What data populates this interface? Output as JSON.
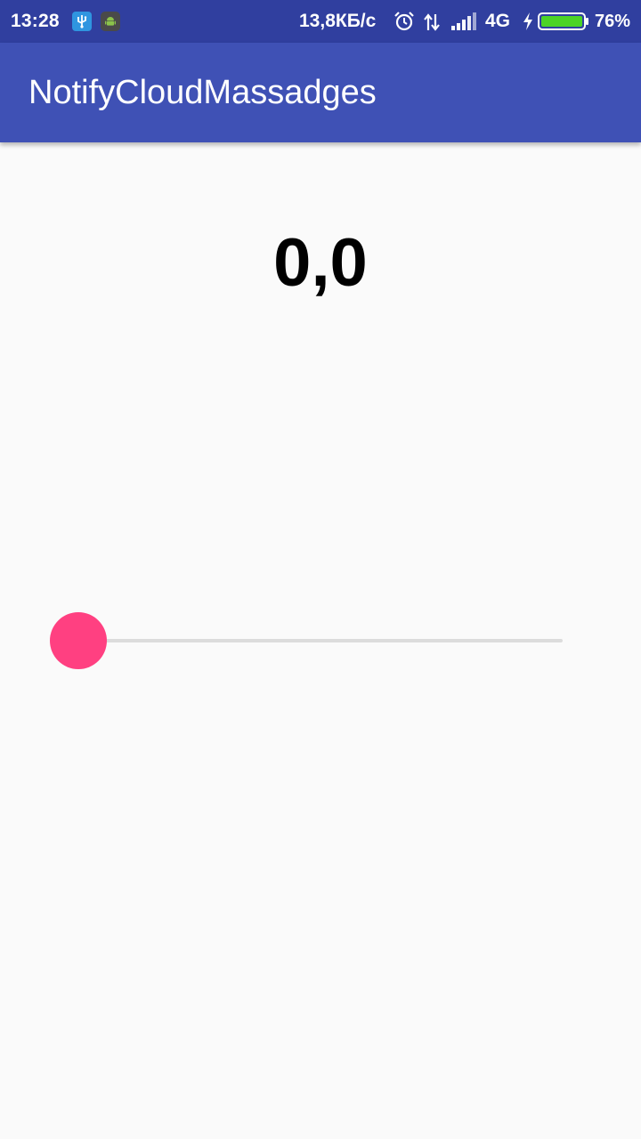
{
  "status_bar": {
    "time": "13:28",
    "usb_icon": "usb-icon",
    "android_icon": "android-debug-icon",
    "net_speed": "13,8КБ/с",
    "alarm_icon": "alarm-clock-icon",
    "data_icon": "data-transfer-icon",
    "signal_icon": "cell-signal-icon",
    "network_type": "4G",
    "charging_icon": "charging-bolt-icon",
    "battery_icon": "battery-icon",
    "battery_level": 76,
    "battery_percent": "76%",
    "background_color": "#303f9f",
    "usb_icon_color": "#2f95e0",
    "battery_fill_color": "#4cd327"
  },
  "toolbar": {
    "title": "NotifyCloudMassadges",
    "background_color": "#3f51b5"
  },
  "main": {
    "value": "0,0",
    "seekbar": {
      "progress": 0,
      "thumb_color": "#ff4081",
      "track_color": "#dcdcdc"
    },
    "background_color": "#fafafa"
  }
}
